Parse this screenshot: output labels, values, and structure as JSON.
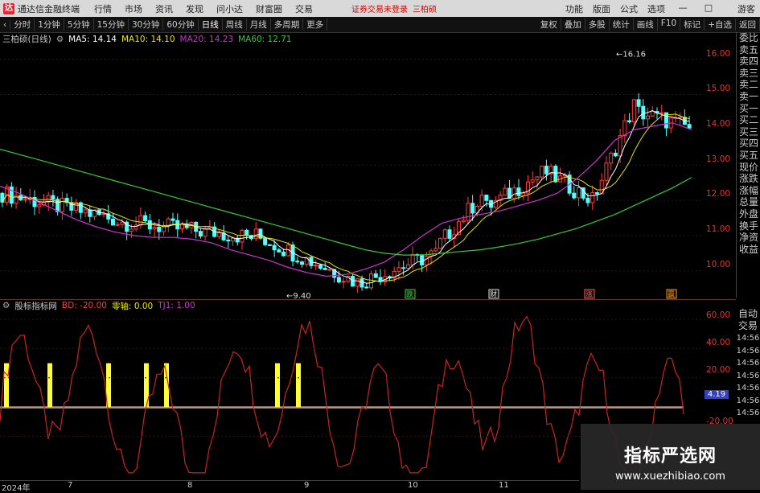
{
  "titlebar": {
    "logo": "达",
    "app_name": "通达信金融终端",
    "menu": [
      "行情",
      "市场",
      "资讯",
      "发现",
      "问小达",
      "财富圈",
      "交易"
    ],
    "notice": "证券交易未登录",
    "stock_name": "三柏硕",
    "right_menu": [
      "功能",
      "版面",
      "公式",
      "选项"
    ],
    "user": "游客"
  },
  "toolbar": {
    "periods": [
      "分时",
      "1分钟",
      "5分钟",
      "15分钟",
      "30分钟",
      "60分钟",
      "日线",
      "周线",
      "月线",
      "多周期",
      "更多"
    ],
    "right": [
      "复权",
      "叠加",
      "多股",
      "统计",
      "画线",
      "F10",
      "标记",
      "+自选",
      "返回"
    ]
  },
  "info": {
    "title": "三柏硕(日线)",
    "ma5": "MA5: 14.14",
    "ma10": "MA10: 14.10",
    "ma20": "MA20: 14.23",
    "ma60": "MA60: 12.71"
  },
  "price_axis": [
    "16.00",
    "15.00",
    "14.00",
    "13.00",
    "12.00",
    "11.00",
    "10.00"
  ],
  "annotations": {
    "high": "16.16",
    "low": "9.40",
    "marks": [
      "跌",
      "财",
      "涨",
      "赢"
    ]
  },
  "side": [
    "委比",
    "卖五",
    "卖四",
    "卖三",
    "卖二",
    "卖一",
    "买一",
    "买二",
    "买三",
    "买四",
    "买五",
    "现价",
    "涨跌",
    "涨幅",
    "总量",
    "外盘",
    "换手",
    "净资",
    "收益"
  ],
  "indicator": {
    "name": "股标指标网",
    "bd": "BD: -20.00",
    "zero": "零轴: 0.00",
    "tj": "TJ1: 1.00",
    "axis": [
      "60.00",
      "40.00",
      "20.00",
      "-20.00"
    ],
    "current": "4.19",
    "side": [
      "自动",
      "交易"
    ],
    "times": [
      "14:56",
      "14:56",
      "14:56",
      "14:56",
      "14:56",
      "14:56",
      "14:56"
    ]
  },
  "dates": [
    "2024年",
    "7",
    "8",
    "9",
    "10",
    "11"
  ],
  "watermark": {
    "title": "指标严选网",
    "url": "www.xuezhibiao.com"
  },
  "colors": {
    "up": "#ff3b3b",
    "down": "#54ffff",
    "ma5": "#ffffff",
    "ma10": "#e6e600",
    "ma20": "#cc33cc",
    "ma60": "#33cc33",
    "signal": "#ffff33"
  },
  "chart_data": {
    "type": "candlestick",
    "ylim": [
      9.2,
      16.4
    ],
    "ma60": [
      13.45,
      13.3,
      13.15,
      13.0,
      12.85,
      12.7,
      12.55,
      12.4,
      12.25,
      12.1,
      11.95,
      11.8,
      11.65,
      11.5,
      11.35,
      11.2,
      11.05,
      10.9,
      10.75,
      10.6,
      10.5,
      10.45,
      10.45,
      10.5,
      10.55,
      10.6,
      10.68,
      10.78,
      10.9,
      11.05,
      11.2,
      11.4,
      11.6,
      11.85,
      12.1,
      12.35,
      12.65
    ],
    "ma20": [
      12.4,
      12.2,
      11.95,
      11.7,
      11.45,
      11.25,
      11.1,
      11.0,
      10.95,
      10.95,
      10.9,
      10.8,
      10.6,
      10.45,
      10.3,
      10.1,
      9.95,
      9.85,
      9.9,
      10.05,
      10.25,
      10.6,
      11.0,
      11.35,
      11.5,
      11.6,
      11.7,
      11.85,
      12.0,
      12.2,
      12.6,
      13.1,
      13.7,
      14.0,
      14.1,
      14.2,
      14.0
    ],
    "signals": [
      1,
      3,
      5,
      7,
      8,
      9,
      14,
      15
    ]
  }
}
